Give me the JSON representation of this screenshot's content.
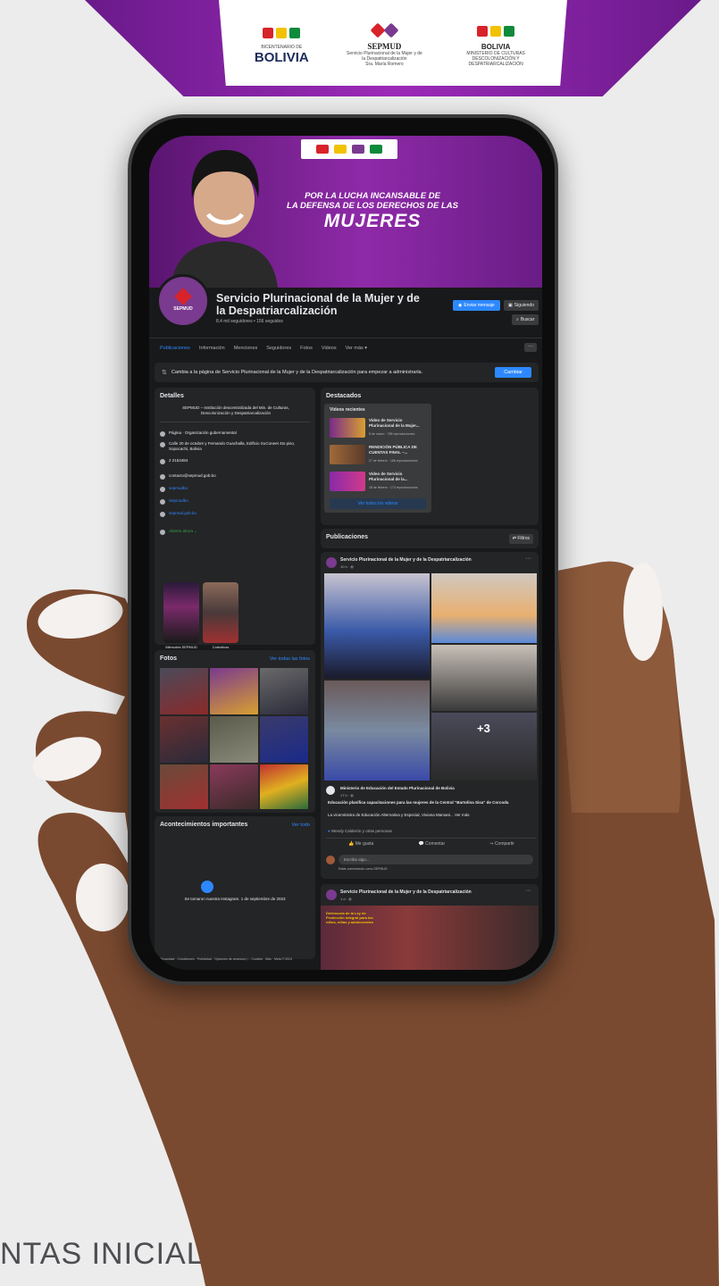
{
  "banner": {
    "logo1_line1": "BICENTENARIO DE",
    "logo1_line2": "BOLIVIA",
    "logo2_title": "SEPMUD",
    "logo2_sub": "Servicio Plurinacional de la Mujer y de la Despatriarcalización",
    "logo2_tag": "Sra. María Romero",
    "logo3_title": "BOLIVIA",
    "logo3_sub": "MINISTERIO DE CULTURAS DESCOLONIZACIÓN Y DESPATRIARCALIZACIÓN"
  },
  "background_text": "NTAS INICIAL - 2",
  "cover": {
    "tagline_line1": "POR LA LUCHA INCANSABLE DE",
    "tagline_line2": "LA DEFENSA DE LOS DERECHOS DE LAS",
    "tagline_big": "MUJERES"
  },
  "profile": {
    "badge": "SEPMUD",
    "name": "Servicio Plurinacional de la Mujer y de la Despatriarcalización",
    "subtitle": "8,4 mil seguidores • 156 seguidos",
    "message_button": "Enviar mensaje",
    "follow_button": "Siguiendo",
    "search_button": "Buscar"
  },
  "tabs": [
    "Publicaciones",
    "Información",
    "Menciones",
    "Seguidores",
    "Fotos",
    "Videos",
    "Ver más ▾"
  ],
  "switch_bar": {
    "text": "Cambia a la página de Servicio Plurinacional de la Mujer y de la Despatriarcalización para empezar a administrarla.",
    "button": "Cambiar"
  },
  "details": {
    "title": "Detalles",
    "description": "SEPMUD – Institución descentralizada del Min. de Culturas, Descolonización y Despatriarcalización",
    "rows": [
      {
        "text": "Página · Organización gubernamental",
        "style": ""
      },
      {
        "text": "Calle 20 de octubre y Fernando Guachalla, Edificio SuConeet 4to piso, Sopocachi, Bolivia",
        "style": ""
      },
      {
        "text": "2 2153484",
        "style": ""
      },
      {
        "text": "contacto@sepmud.gob.bo",
        "style": ""
      },
      {
        "text": "sepmudbo",
        "style": "link"
      },
      {
        "text": "Sepmudbo",
        "style": "link"
      },
      {
        "text": "sepmud.gob.bo",
        "style": "link"
      },
      {
        "text": "Abierto ahora ⌄",
        "style": "green"
      }
    ],
    "reels": [
      {
        "caption": "Miércoles SEPMUD"
      },
      {
        "caption": "Colectivos"
      }
    ]
  },
  "photos": {
    "title": "Fotos",
    "link": "Ver todas las fotos"
  },
  "events": {
    "title": "Acontecimientos importantes",
    "link": "Ver todo",
    "text": "Se tomaron nuestra Instagram. 1 de septiembre de 2023"
  },
  "featured": {
    "title": "Destacados",
    "section": "Videos recientes",
    "videos": [
      {
        "title": "Video de Servicio Plurinacional de la Mujer...",
        "meta": "8 de marzo · 785 reproducciones"
      },
      {
        "title": "RENDICIÓN PÚBLICA DE CUENTAS FINAL –...",
        "meta": "27 de febrero · 186 reproducciones"
      },
      {
        "title": "Video de Servicio Plurinacional de la...",
        "meta": "18 de febrero · 174 reproducciones"
      }
    ],
    "all_button": "Ver todos los videos"
  },
  "posts": {
    "title": "Publicaciones",
    "filter": "⇄ Filtros",
    "post1": {
      "author": "Servicio Plurinacional de la Mujer y de la Despatriarcalización",
      "time": "10 h · ◍",
      "plus_count": "+3",
      "shared_author": "Ministerio de Educación del Estado Plurinacional de Bolivia",
      "shared_time": "17 h · ◍",
      "shared_headline": "Educación planifica capacitaciones para las mujeres de la Central \"Bartolina Sisa\" de Corcoda",
      "shared_body": "La viceministra de Educación Alternativa y Especial, Viviana Mamani... Ver más",
      "likes": "Wendy Calderón y otras personas",
      "like": "Me gusta",
      "comment": "Comentar",
      "share": "Compartir",
      "comment_placeholder": "Escribe algo...",
      "comment_note": "Estás comentando como SEPMUD"
    },
    "post2": {
      "author": "Servicio Plurinacional de la Mujer y de la Despatriarcalización",
      "time": "1 d · ◍",
      "img_caption": "Defensoría de la Ley de Protección integral para los niños, niñas y adolescentes"
    }
  },
  "footer_links": "Privacidad · Condiciones · Publicidad · Opciones de anuncios ▷ · Cookies · Más · Meta © 2024"
}
